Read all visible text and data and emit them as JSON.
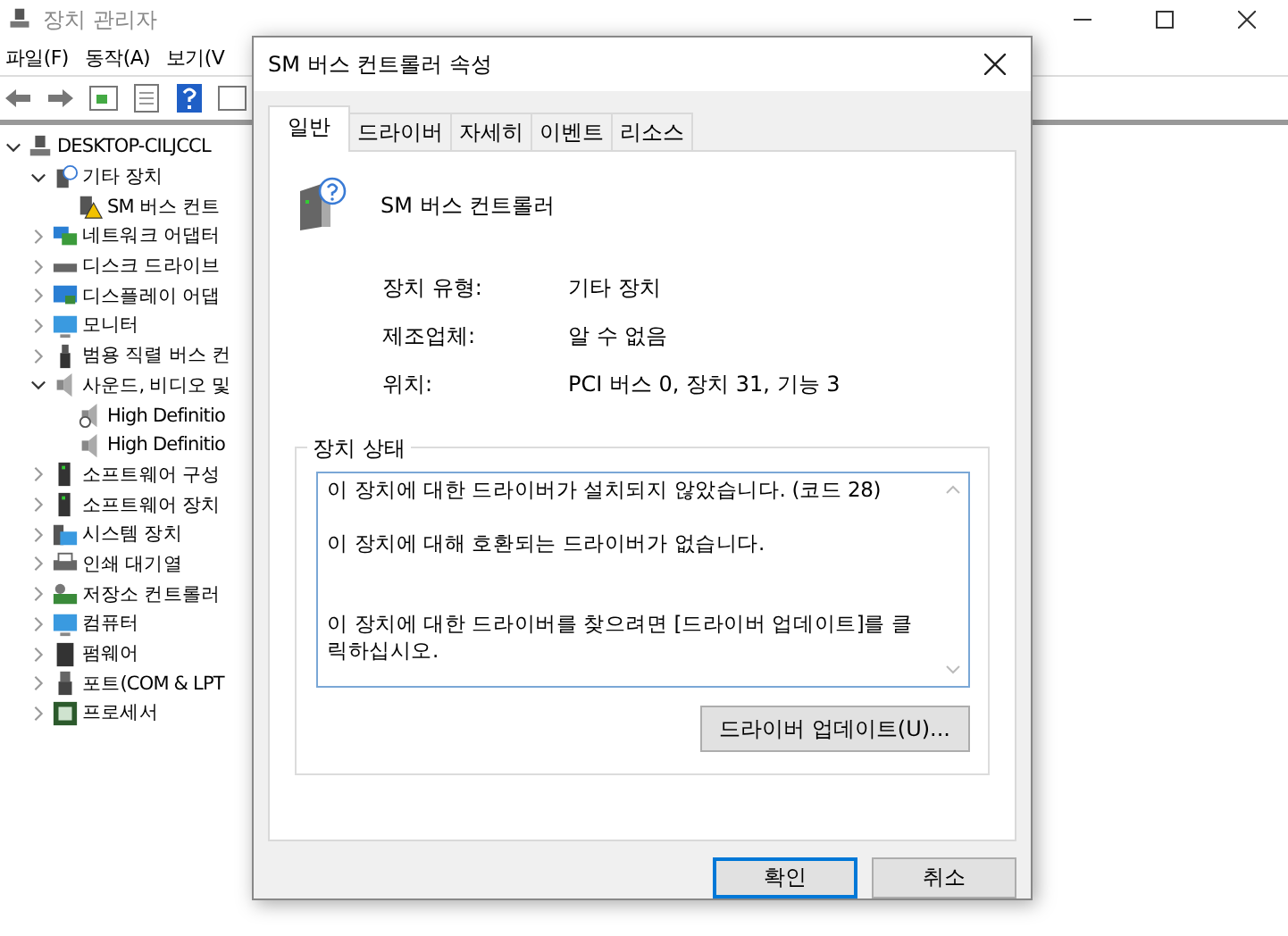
{
  "window": {
    "title": "장치 관리자",
    "menu": [
      "파일(F)",
      "동작(A)",
      "보기(V"
    ]
  },
  "tree": [
    {
      "label": "DESKTOP-CILJCCL",
      "kind": "computer",
      "expanded": true,
      "children": [
        {
          "label": "기타 장치",
          "kind": "unknown",
          "expanded": true,
          "children": [
            {
              "label": "SM 버스 컨트",
              "warning": true
            }
          ]
        },
        {
          "label": "네트워크 어댑터",
          "kind": "network",
          "expanded": false
        },
        {
          "label": "디스크 드라이브",
          "kind": "disk",
          "expanded": false
        },
        {
          "label": "디스플레이 어댑",
          "kind": "display",
          "expanded": false
        },
        {
          "label": "모니터",
          "kind": "monitor",
          "expanded": false
        },
        {
          "label": "범용 직렬 버스 컨",
          "kind": "usb",
          "expanded": false
        },
        {
          "label": "사운드, 비디오 및",
          "kind": "speaker",
          "expanded": true,
          "children": [
            {
              "label": "High Definitio",
              "kind": "speakerdown",
              "warning": false
            },
            {
              "label": "High Definitio",
              "kind": "speaker",
              "warning": false
            }
          ]
        },
        {
          "label": "소프트웨어 구성",
          "kind": "tower",
          "expanded": false
        },
        {
          "label": "소프트웨어 장치",
          "kind": "tower",
          "expanded": false
        },
        {
          "label": "시스템 장치",
          "kind": "system",
          "expanded": false
        },
        {
          "label": "인쇄 대기열",
          "kind": "printer",
          "expanded": false
        },
        {
          "label": "저장소 컨트롤러",
          "kind": "storage",
          "expanded": false
        },
        {
          "label": "컴퓨터",
          "kind": "monitor",
          "expanded": false
        },
        {
          "label": "펌웨어",
          "kind": "chip",
          "expanded": false
        },
        {
          "label": "포트(COM & LPT",
          "kind": "port",
          "expanded": false
        },
        {
          "label": "프로세서",
          "kind": "processor",
          "expanded": false
        }
      ]
    }
  ],
  "dialog": {
    "title": "SM 버스 컨트롤러 속성",
    "tabs": [
      {
        "label": "일반",
        "selected": true
      },
      {
        "label": "드라이버",
        "selected": false
      },
      {
        "label": "자세히",
        "selected": false
      },
      {
        "label": "이벤트",
        "selected": false
      },
      {
        "label": "리소스",
        "selected": false
      }
    ],
    "device_name": "SM 버스 컨트롤러",
    "properties": [
      {
        "label": "장치 유형:",
        "value": "기타 장치"
      },
      {
        "label": "제조업체:",
        "value": "알 수 없음"
      },
      {
        "label": "위치:",
        "value": "PCI 버스 0, 장치 31, 기능 3"
      }
    ],
    "status": {
      "title": "장치 상태",
      "paragraphs": [
        "이 장치에 대한 드라이버가 설치되지 않았습니다. (코드 28)",
        "이 장치에 대해 호환되는 드라이버가 없습니다.",
        "이 장치에 대한 드라이버를 찾으려면 [드라이버 업데이트]를 클릭하십시오."
      ],
      "button": "드라이버 업데이트(U)..."
    },
    "buttons": [
      {
        "label": "확인",
        "default": true
      },
      {
        "label": "취소",
        "default": false
      }
    ]
  }
}
